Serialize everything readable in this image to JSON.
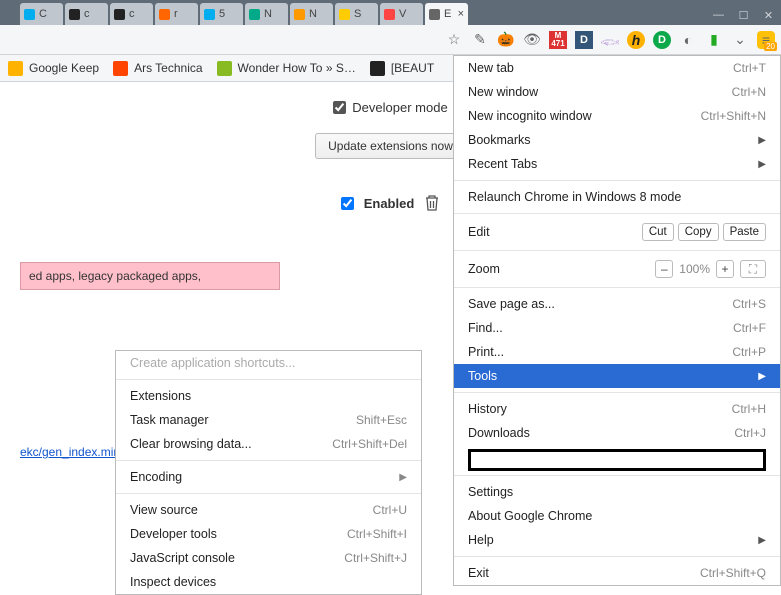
{
  "window": {
    "sys": [
      "—",
      "☐",
      "✕"
    ]
  },
  "tabs": [
    {
      "label": "C",
      "fav": "#00adee"
    },
    {
      "label": "c",
      "fav": "#222"
    },
    {
      "label": "c",
      "fav": "#222"
    },
    {
      "label": "r",
      "fav": "#f60"
    },
    {
      "label": "5",
      "fav": "#00adee"
    },
    {
      "label": "N",
      "fav": "#0a8"
    },
    {
      "label": "N",
      "fav": "#f90"
    },
    {
      "label": "S",
      "fav": "#fc0"
    },
    {
      "label": "V",
      "fav": "#f44"
    },
    {
      "label": "E",
      "fav": "#666",
      "active": true,
      "close": "×"
    }
  ],
  "toolbar_icons": [
    "star",
    "pencil",
    "pumpkin",
    "eye",
    "m_badge",
    "D",
    "feather",
    "hola",
    "disconnect",
    "grey1",
    "green",
    "pocket",
    "menu_20"
  ],
  "toolbar_badge": "20",
  "m_badge_text": "471",
  "bookmarks": [
    {
      "label": "Google Keep",
      "color": "#ffb300"
    },
    {
      "label": "Ars Technica",
      "color": "#ff4500"
    },
    {
      "label": "Wonder How To » S…",
      "color": "#8b2"
    },
    {
      "label": "[BEAUT",
      "color": "#222"
    }
  ],
  "page": {
    "dev_mode_label": "Developer mode",
    "update_btn": "Update extensions now",
    "enabled_label": "Enabled",
    "pink_text": "ed apps, legacy packaged apps,",
    "link_text": "ekc/gen_index.min.h"
  },
  "menu": [
    {
      "t": "item",
      "label": "New tab",
      "sc": "Ctrl+T"
    },
    {
      "t": "item",
      "label": "New window",
      "sc": "Ctrl+N"
    },
    {
      "t": "item",
      "label": "New incognito window",
      "sc": "Ctrl+Shift+N"
    },
    {
      "t": "sub",
      "label": "Bookmarks"
    },
    {
      "t": "sub",
      "label": "Recent Tabs"
    },
    {
      "t": "sep"
    },
    {
      "t": "item",
      "label": "Relaunch Chrome in Windows 8 mode"
    },
    {
      "t": "sep"
    },
    {
      "t": "edit",
      "label": "Edit",
      "cut": "Cut",
      "copy": "Copy",
      "paste": "Paste"
    },
    {
      "t": "sep"
    },
    {
      "t": "zoom",
      "label": "Zoom",
      "pct": "100%"
    },
    {
      "t": "sep"
    },
    {
      "t": "item",
      "label": "Save page as...",
      "sc": "Ctrl+S"
    },
    {
      "t": "item",
      "label": "Find...",
      "sc": "Ctrl+F"
    },
    {
      "t": "item",
      "label": "Print...",
      "sc": "Ctrl+P"
    },
    {
      "t": "sel",
      "label": "Tools"
    },
    {
      "t": "sep"
    },
    {
      "t": "item",
      "label": "History",
      "sc": "Ctrl+H"
    },
    {
      "t": "item",
      "label": "Downloads",
      "sc": "Ctrl+J"
    },
    {
      "t": "redact"
    },
    {
      "t": "sep"
    },
    {
      "t": "item",
      "label": "Settings"
    },
    {
      "t": "item",
      "label": "About Google Chrome"
    },
    {
      "t": "sub",
      "label": "Help"
    },
    {
      "t": "sep"
    },
    {
      "t": "item",
      "label": "Exit",
      "sc": "Ctrl+Shift+Q"
    }
  ],
  "submenu": [
    {
      "t": "dis",
      "label": "Create application shortcuts..."
    },
    {
      "t": "sep"
    },
    {
      "t": "item",
      "label": "Extensions"
    },
    {
      "t": "item",
      "label": "Task manager",
      "sc": "Shift+Esc"
    },
    {
      "t": "item",
      "label": "Clear browsing data...",
      "sc": "Ctrl+Shift+Del"
    },
    {
      "t": "sep"
    },
    {
      "t": "sub",
      "label": "Encoding"
    },
    {
      "t": "sep"
    },
    {
      "t": "item",
      "label": "View source",
      "sc": "Ctrl+U"
    },
    {
      "t": "item",
      "label": "Developer tools",
      "sc": "Ctrl+Shift+I"
    },
    {
      "t": "item",
      "label": "JavaScript console",
      "sc": "Ctrl+Shift+J"
    },
    {
      "t": "item",
      "label": "Inspect devices"
    }
  ]
}
